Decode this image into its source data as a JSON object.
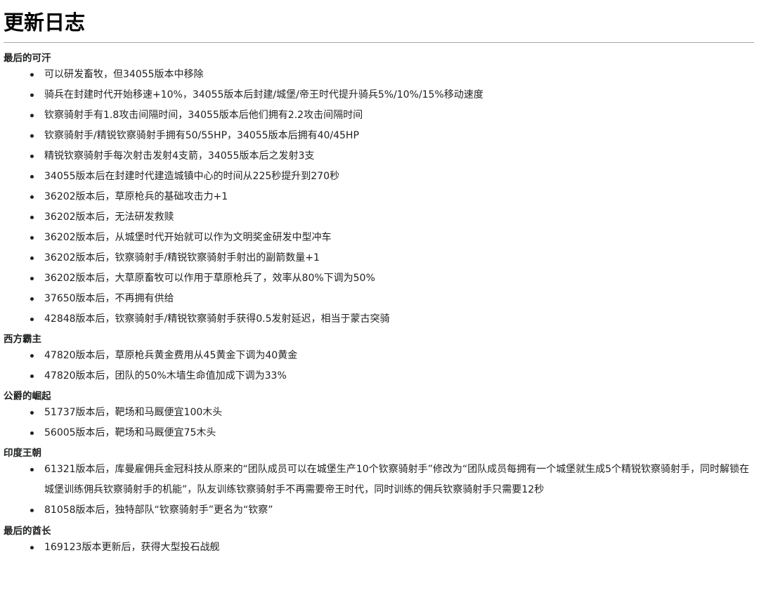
{
  "page": {
    "title": "更新日志"
  },
  "sections": [
    {
      "title": "最后的可汗",
      "items": [
        "可以研发畜牧，但34055版本中移除",
        "骑兵在封建时代开始移速+10%，34055版本后封建/城堡/帝王时代提升骑兵5%/10%/15%移动速度",
        "钦察骑射手有1.8攻击间隔时间，34055版本后他们拥有2.2攻击间隔时间",
        "钦察骑射手/精锐钦察骑射手拥有50/55HP，34055版本后拥有40/45HP",
        "精锐钦察骑射手每次射击发射4支箭，34055版本后之发射3支",
        "34055版本后在封建时代建造城镇中心的时间从225秒提升到270秒",
        "36202版本后，草原枪兵的基础攻击力+1",
        "36202版本后，无法研发救赎",
        "36202版本后，从城堡时代开始就可以作为文明奖金研发中型冲车",
        "36202版本后，钦察骑射手/精锐钦察骑射手射出的副箭数量+1",
        "36202版本后，大草原畜牧可以作用于草原枪兵了，效率从80%下调为50%",
        "37650版本后，不再拥有供给",
        "42848版本后，钦察骑射手/精锐钦察骑射手获得0.5发射延迟，相当于蒙古突骑"
      ]
    },
    {
      "title": "西方霸主",
      "items": [
        "47820版本后，草原枪兵黄金费用从45黄金下调为40黄金",
        "47820版本后，团队的50%木墙生命值加成下调为33%"
      ]
    },
    {
      "title": "公爵的崛起",
      "items": [
        "51737版本后，靶场和马厩便宜100木头",
        "56005版本后，靶场和马厩便宜75木头"
      ]
    },
    {
      "title": "印度王朝",
      "items": [
        "61321版本后，库曼雇佣兵金冠科技从原来的“团队成员可以在城堡生产10个钦察骑射手”修改为“团队成员每拥有一个城堡就生成5个精锐钦察骑射手，同时解锁在城堡训练佣兵钦察骑射手的机能”，队友训练钦察骑射手不再需要帝王时代，同时训练的佣兵钦察骑射手只需要12秒",
        "81058版本后，独特部队“钦察骑射手”更名为“钦察”"
      ]
    },
    {
      "title": "最后的酋长",
      "items": [
        "169123版本更新后，获得大型投石战舰"
      ]
    }
  ]
}
